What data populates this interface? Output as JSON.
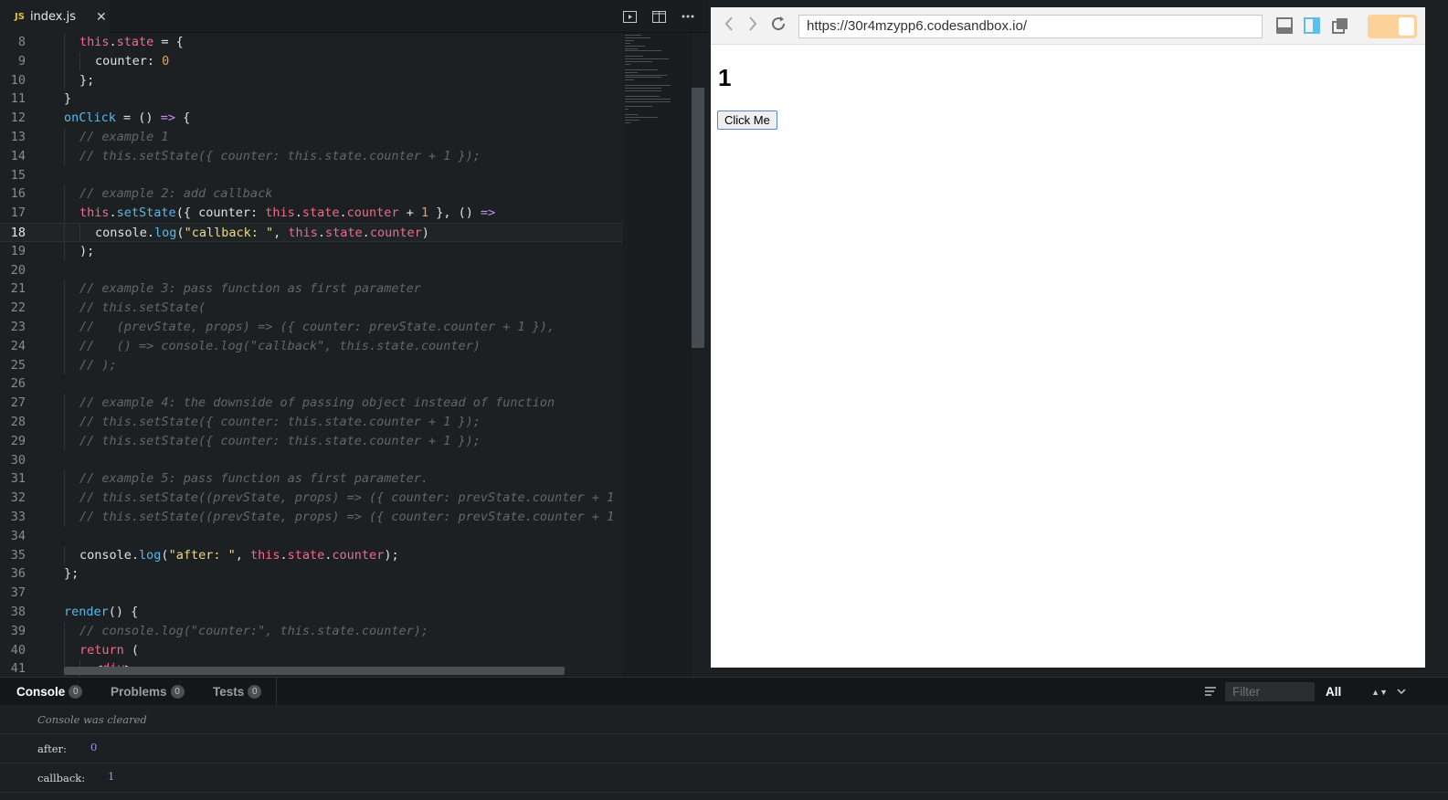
{
  "editor": {
    "tab": {
      "badge": "JS",
      "label": "index.js"
    },
    "lines": [
      {
        "n": "8",
        "indent": 1,
        "html": [
          [
            "kw",
            "this"
          ],
          [
            "",
            "."
          ],
          [
            "prop",
            "state"
          ],
          [
            "",
            " = {"
          ]
        ]
      },
      {
        "n": "9",
        "indent": 2,
        "html": [
          [
            "",
            "counter: "
          ],
          [
            "num",
            "0"
          ]
        ]
      },
      {
        "n": "10",
        "indent": 1,
        "html": [
          [
            "",
            "};"
          ]
        ]
      },
      {
        "n": "11",
        "indent": 0,
        "html": [
          [
            "",
            "}"
          ]
        ]
      },
      {
        "n": "12",
        "indent": 0,
        "html": [
          [
            "fn",
            "onClick"
          ],
          [
            "",
            " = () "
          ],
          [
            "ar",
            "=>"
          ],
          [
            "",
            " {"
          ]
        ]
      },
      {
        "n": "13",
        "indent": 1,
        "html": [
          [
            "cm",
            "// example 1"
          ]
        ]
      },
      {
        "n": "14",
        "indent": 1,
        "html": [
          [
            "cm",
            "// this.setState({ counter: this.state.counter + 1 });"
          ]
        ]
      },
      {
        "n": "15",
        "indent": 0,
        "html": []
      },
      {
        "n": "16",
        "indent": 1,
        "html": [
          [
            "cm",
            "// example 2: add callback"
          ]
        ]
      },
      {
        "n": "17",
        "indent": 1,
        "html": [
          [
            "kw",
            "this"
          ],
          [
            "",
            "."
          ],
          [
            "fn",
            "setState"
          ],
          [
            "",
            "({ counter: "
          ],
          [
            "kw",
            "this"
          ],
          [
            "",
            "."
          ],
          [
            "prop",
            "state"
          ],
          [
            "",
            "."
          ],
          [
            "prop",
            "counter"
          ],
          [
            "",
            " + "
          ],
          [
            "num",
            "1"
          ],
          [
            "",
            " }, () "
          ],
          [
            "ar",
            "=>"
          ]
        ]
      },
      {
        "n": "18",
        "indent": 2,
        "current": true,
        "html": [
          [
            "",
            "console."
          ],
          [
            "fn",
            "log"
          ],
          [
            "",
            "("
          ],
          [
            "str",
            "\"callback: \""
          ],
          [
            "",
            ", "
          ],
          [
            "kw",
            "this"
          ],
          [
            "",
            "."
          ],
          [
            "prop",
            "state"
          ],
          [
            "",
            "."
          ],
          [
            "prop",
            "counter"
          ],
          [
            "",
            ")"
          ]
        ]
      },
      {
        "n": "19",
        "indent": 1,
        "html": [
          [
            "",
            ");"
          ]
        ]
      },
      {
        "n": "20",
        "indent": 0,
        "html": []
      },
      {
        "n": "21",
        "indent": 1,
        "html": [
          [
            "cm",
            "// example 3: pass function as first parameter"
          ]
        ]
      },
      {
        "n": "22",
        "indent": 1,
        "html": [
          [
            "cm",
            "// this.setState("
          ]
        ]
      },
      {
        "n": "23",
        "indent": 1,
        "html": [
          [
            "cm",
            "//   (prevState, props) => ({ counter: prevState.counter + 1 }),"
          ]
        ]
      },
      {
        "n": "24",
        "indent": 1,
        "html": [
          [
            "cm",
            "//   () => console.log(\"callback\", this.state.counter)"
          ]
        ]
      },
      {
        "n": "25",
        "indent": 1,
        "html": [
          [
            "cm",
            "// );"
          ]
        ]
      },
      {
        "n": "26",
        "indent": 0,
        "html": []
      },
      {
        "n": "27",
        "indent": 1,
        "html": [
          [
            "cm",
            "// example 4: the downside of passing object instead of function"
          ]
        ]
      },
      {
        "n": "28",
        "indent": 1,
        "html": [
          [
            "cm",
            "// this.setState({ counter: this.state.counter + 1 });"
          ]
        ]
      },
      {
        "n": "29",
        "indent": 1,
        "html": [
          [
            "cm",
            "// this.setState({ counter: this.state.counter + 1 });"
          ]
        ]
      },
      {
        "n": "30",
        "indent": 0,
        "html": []
      },
      {
        "n": "31",
        "indent": 1,
        "html": [
          [
            "cm",
            "// example 5: pass function as first parameter."
          ]
        ]
      },
      {
        "n": "32",
        "indent": 1,
        "html": [
          [
            "cm",
            "// this.setState((prevState, props) => ({ counter: prevState.counter + 1"
          ]
        ]
      },
      {
        "n": "33",
        "indent": 1,
        "html": [
          [
            "cm",
            "// this.setState((prevState, props) => ({ counter: prevState.counter + 1"
          ]
        ]
      },
      {
        "n": "34",
        "indent": 0,
        "html": []
      },
      {
        "n": "35",
        "indent": 1,
        "html": [
          [
            "",
            "console."
          ],
          [
            "fn",
            "log"
          ],
          [
            "",
            "("
          ],
          [
            "str",
            "\"after: \""
          ],
          [
            "",
            ", "
          ],
          [
            "kw",
            "this"
          ],
          [
            "",
            "."
          ],
          [
            "prop",
            "state"
          ],
          [
            "",
            "."
          ],
          [
            "prop",
            "counter"
          ],
          [
            "",
            ");"
          ]
        ]
      },
      {
        "n": "36",
        "indent": 0,
        "html": [
          [
            "",
            "};"
          ]
        ]
      },
      {
        "n": "37",
        "indent": 0,
        "html": []
      },
      {
        "n": "38",
        "indent": 0,
        "html": [
          [
            "fn",
            "render"
          ],
          [
            "",
            "() {"
          ]
        ]
      },
      {
        "n": "39",
        "indent": 1,
        "html": [
          [
            "cm",
            "// console.log(\"counter:\", this.state.counter);"
          ]
        ]
      },
      {
        "n": "40",
        "indent": 1,
        "html": [
          [
            "kw",
            "return"
          ],
          [
            "",
            " ("
          ]
        ]
      },
      {
        "n": "41",
        "indent": 2,
        "html": [
          [
            "",
            "<"
          ],
          [
            "kw",
            "div"
          ],
          [
            "",
            ">"
          ]
        ]
      }
    ]
  },
  "preview": {
    "url": "https://30r4mzypp6.codesandbox.io/",
    "heading": "1",
    "button_label": "Click Me"
  },
  "console": {
    "tabs": [
      {
        "label": "Console",
        "count": "0",
        "active": true
      },
      {
        "label": "Problems",
        "count": "0",
        "active": false
      },
      {
        "label": "Tests",
        "count": "0",
        "active": false
      }
    ],
    "filter_placeholder": "Filter",
    "level": "All",
    "cleared_text": "Console was cleared",
    "logs": [
      {
        "label": "after:",
        "value": "0"
      },
      {
        "label": "callback:",
        "value": "1"
      }
    ]
  },
  "colors": {
    "accent_toggle": "#fcd29a",
    "keyword": "#f06b8a",
    "function": "#5ab8e8",
    "string": "#f0d88a"
  }
}
